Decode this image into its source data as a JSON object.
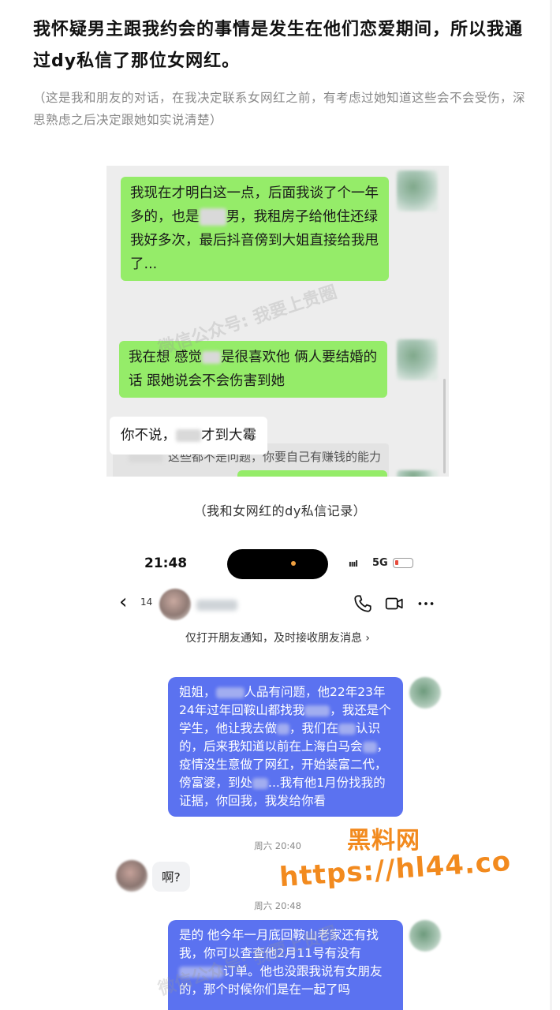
{
  "article": {
    "heading": "我怀疑男主跟我约会的事情是发生在他们恋爱期间，所以我通过dy私信了那位女网红。",
    "note": "（这是我和朋友的对话，在我决定联系女网红之前，有考虑过她知道这些会不会受伤，深思熟虑之后决定跟她如实说清楚）",
    "caption": "（我和女网红的dy私信记录）"
  },
  "chat1": {
    "msg1_a": "我现在才明白这一点，后面我谈了个一年多的，也是",
    "msg1_b": "男，我租房子给他住还绿我好多次，最后抖音傍到大姐直接给我甩了...",
    "quote_text": "这些都不是问题，你要自己有赚钱的能力",
    "msg2_a": "我在想 感觉",
    "msg2_b": "是很喜欢他 俩人要结婚的话 跟她说会不会伤害到她",
    "msg3_a": "你不说，",
    "msg3_b": "才到大霉",
    "watermark": "微信公众号: 我要上贵圈"
  },
  "chat2": {
    "status": {
      "time": "21:48",
      "signal_glyph": "ıııl",
      "network": "5G"
    },
    "nav": {
      "back_glyph": "‹",
      "unread_count": "14"
    },
    "notice": "仅打开朋友通知，及时接收朋友消息",
    "msg1": {
      "p1": "姐姐，",
      "p2": "人品有问题，他22年23年24年过年回鞍山都找我",
      "p3": "，我还是个学生，他让我去做",
      "p4": "，我们在",
      "p5": "认识的，后来我知道以前在上海白马会",
      "p6": "，疫情没生意做了网红，开始装富二代，傍富婆，到处",
      "p7": "...我有他1月份找我的证据，你回我，我发给你看"
    },
    "ts1": "周六 20:40",
    "reply": "啊?",
    "ts2": "周六 20:48",
    "msg2": {
      "p1": "是的 他今年一月底回鞍山老家还有找我，你可以查查他2月11号有没有",
      "p2": "订单。他也没跟我说有女朋友的，那个时候你们是在一起了吗"
    },
    "watermark": "微信公众号: 我要上贵圈"
  },
  "site_watermark": {
    "name": "黑料网",
    "url": "https://hl44.co"
  },
  "colors": {
    "wechat_green": "#95ec69",
    "douyin_blue": "#5b72f0",
    "watermark_orange": "#f28a1e"
  }
}
